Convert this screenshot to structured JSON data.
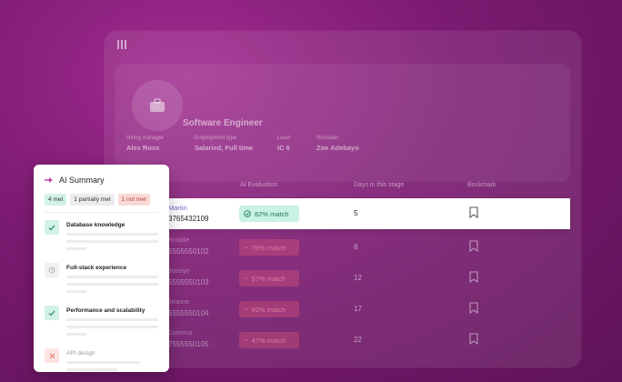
{
  "job": {
    "title": "Software Engineer",
    "meta": [
      {
        "label": "Hiring manager",
        "value": "Alex Ross"
      },
      {
        "label": "Employment type",
        "value": "Salaried, Full time"
      },
      {
        "label": "Level",
        "value": "IC 6"
      },
      {
        "label": "Recruiter",
        "value": "Zoe Adebayo"
      }
    ]
  },
  "table": {
    "headers": {
      "ai_evaluation": "AI Evaluation",
      "days": "Days in this stage",
      "bookmark": "Bookmark"
    },
    "active_row": {
      "name": "Martin",
      "phone": "3765432109",
      "match": "82% match",
      "days": "5"
    },
    "ghost_rows": [
      {
        "name": "Rosalie",
        "phone": "5555550102",
        "match": "75% match",
        "days": "8"
      },
      {
        "name": "Jocelyn",
        "phone": "5555550103",
        "match": "57% match",
        "days": "12"
      },
      {
        "name": "Jeanne",
        "phone": "5555550104",
        "match": "60% match",
        "days": "17"
      },
      {
        "name": "Caterina",
        "phone": "7555550105",
        "match": "47% match",
        "days": "22"
      }
    ]
  },
  "ai_summary": {
    "title": "AI Summary",
    "pills": {
      "met": "4 met",
      "partial": "1 partially met",
      "not_met": "1 not met"
    },
    "criteria": [
      {
        "label": "Database knowledge",
        "status": "met"
      },
      {
        "label": "Full-stack experience",
        "status": "partial"
      },
      {
        "label": "Performance and scalability",
        "status": "met"
      },
      {
        "label": "API design",
        "status": "not_met"
      }
    ]
  },
  "colors": {
    "accent": "#7a1a70",
    "met": "#d3f2e7",
    "not_met": "#f9d9d6",
    "link": "#6c6cd0"
  }
}
